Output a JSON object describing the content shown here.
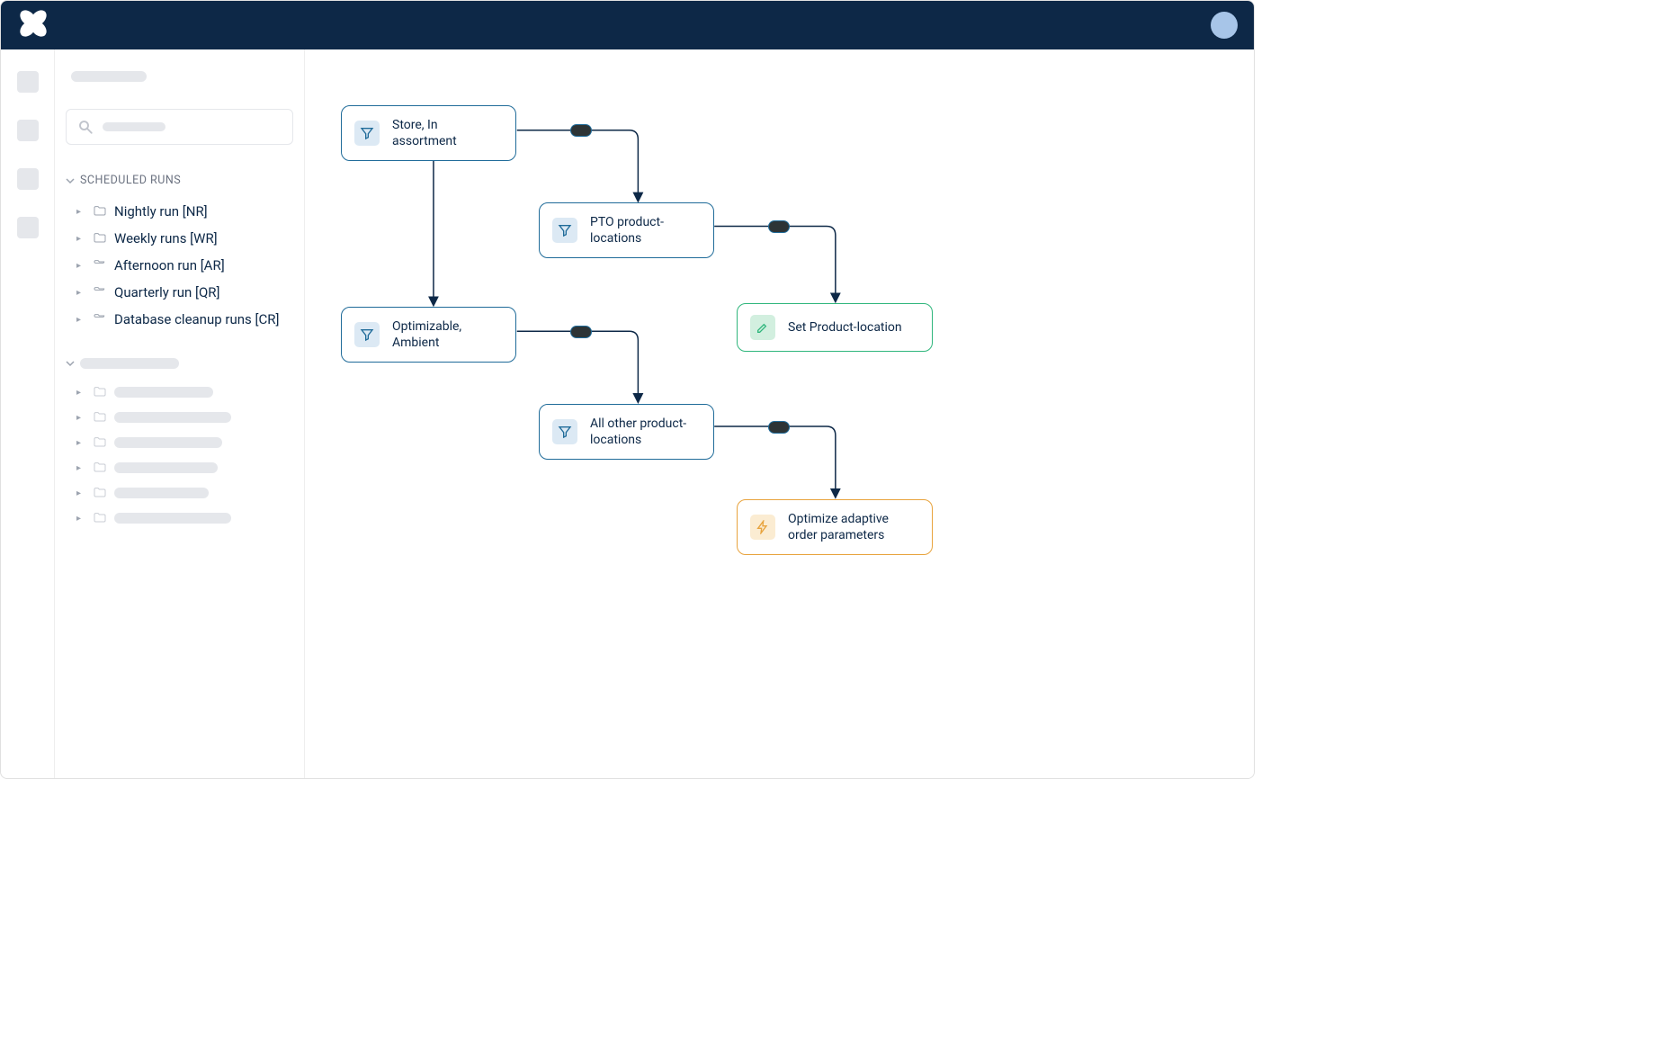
{
  "sidebar": {
    "section_title": "SCHEDULED RUNS",
    "items": [
      "Nightly run [NR]",
      "Weekly runs [WR]",
      "Afternoon run [AR]",
      "Quarterly run [QR]",
      "Database cleanup runs [CR]"
    ]
  },
  "nodes": {
    "n1": "Store, In assortment",
    "n2": "PTO product-locations",
    "n3": "Optimizable, Ambient",
    "n4": "Set Product-location",
    "n5": "All other product-locations",
    "n6": "Optimize adaptive order parameters"
  }
}
